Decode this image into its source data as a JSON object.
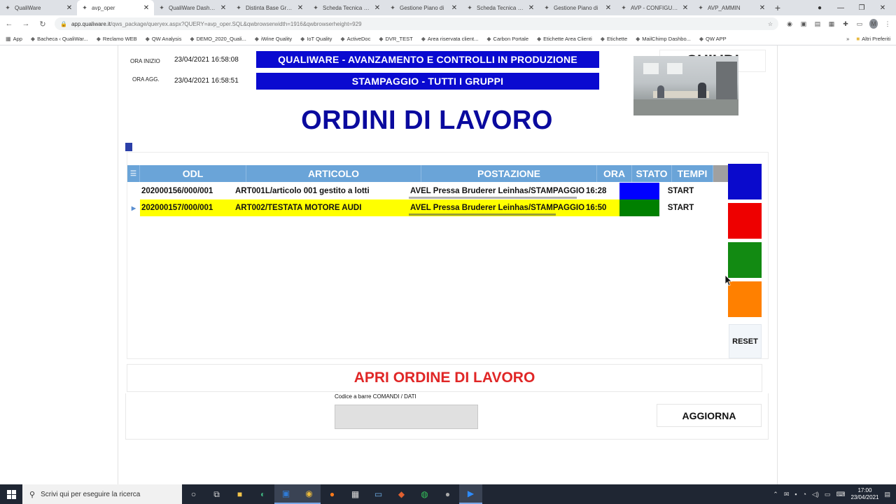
{
  "browser": {
    "tabs": [
      {
        "label": "QualiWare",
        "active": false
      },
      {
        "label": "avp_oper",
        "active": true
      },
      {
        "label": "QualiWare Dashboard",
        "active": false
      },
      {
        "label": "Distinta Base Grafica",
        "active": false
      },
      {
        "label": "Scheda Tecnica Prodotto",
        "active": false
      },
      {
        "label": "Gestione Piano di",
        "active": false
      },
      {
        "label": "Scheda Tecnica Prodotto",
        "active": false
      },
      {
        "label": "Gestione Piano di",
        "active": false
      },
      {
        "label": "AVP - CONFIGURA",
        "active": false
      },
      {
        "label": "AVP_AMMIN",
        "active": false
      }
    ],
    "url_main": "app.qualiware.it",
    "url_rest": "/qws_package/queryex.aspx?QUERY=avp_oper.SQL&qwbrowserwidth=1916&qwbrowserheight=929",
    "profile_initial": "M",
    "bookmarks": [
      "App",
      "Bacheca ‹ QualiWar...",
      "Reclamo WEB",
      "QW Analysis",
      "DEMO_2020_Quali...",
      "iWine Quality",
      "IoT Quality",
      "ActiveDoc",
      "DVR_TEST",
      "Area riservata client...",
      "Carbon Portale",
      "Etichette Area Clienti",
      "Etichette",
      "MailChimp Dashbo...",
      "QW APP"
    ],
    "bookmarks_more": "Altri Preferiti"
  },
  "header": {
    "start_label": "ORA INIZIO",
    "start_value": "23/04/2021 16:58:08",
    "update_label": "ORA AGG.",
    "update_value": "23/04/2021 16:58:51",
    "banner_title": "QUALIWARE - AVANZAMENTO E CONTROLLI IN PRODUZIONE",
    "banner_subtitle": "STAMPAGGIO - TUTTI I GRUPPI",
    "close_label": "CHIUDI",
    "page_title": "ORDINI DI LAVORO"
  },
  "grid": {
    "columns": [
      "ODL",
      "ARTICOLO",
      "POSTAZIONE",
      "ORA",
      "STATO",
      "TEMPI"
    ],
    "rows": [
      {
        "odl": "202000156/000/001",
        "articolo": "ART001L/articolo 001 gestito a lotti",
        "postazione": "AVEL Pressa Bruderer Leinhas/STAMPAGGIO",
        "ora": "16:28",
        "stato_color": "#0000ff",
        "tempi": "START",
        "highlight": false
      },
      {
        "odl": "202000157/000/001",
        "articolo": "ART002/TESTATA MOTORE AUDI",
        "postazione": "AVEL Pressa Bruderer Leinhas/STAMPAGGIO",
        "ora": "16:50",
        "stato_color": "#008000",
        "tempi": "START",
        "highlight": true
      }
    ]
  },
  "side_buttons": {
    "colors": [
      "#0a0acc",
      "#ee0000",
      "#128a12",
      "#ff8000"
    ],
    "reset_label": "RESET"
  },
  "footer": {
    "open_label": "APRI ORDINE DI LAVORO",
    "barcode_label": "Codice a barre COMANDI / DATI",
    "barcode_value": "",
    "update_label": "AGGIORNA"
  },
  "taskbar": {
    "search_placeholder": "Scrivi qui per eseguire la ricerca",
    "time": "17:00",
    "date": "23/04/2021"
  }
}
